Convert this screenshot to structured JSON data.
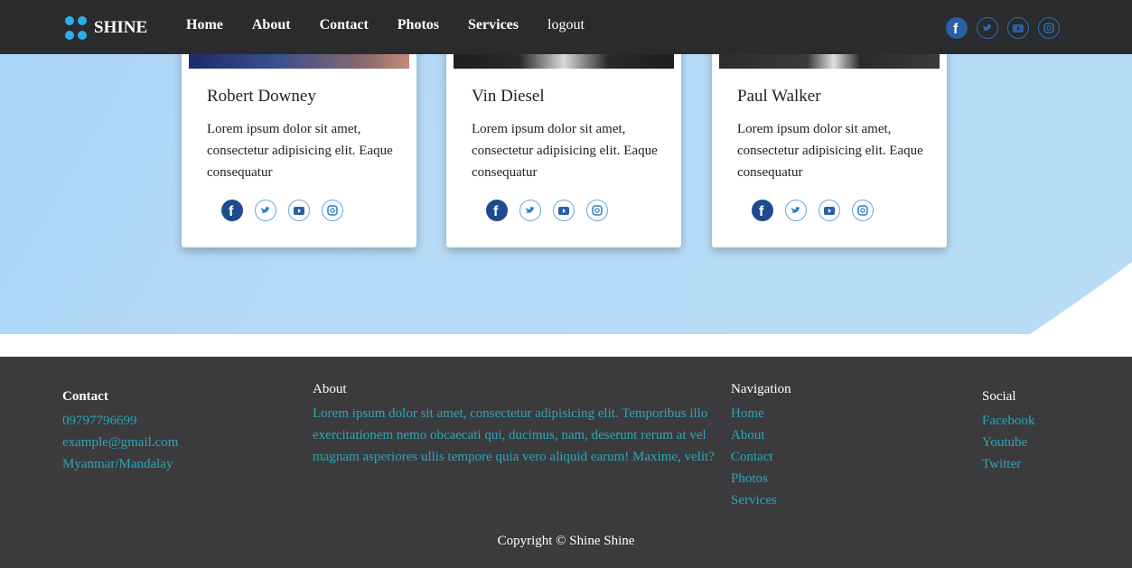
{
  "brand": {
    "name": "SHINE"
  },
  "nav": {
    "links": [
      "Home",
      "About",
      "Contact",
      "Photos",
      "Services",
      "logout"
    ],
    "social": [
      "facebook-icon",
      "twitter-icon",
      "youtube-icon",
      "instagram-icon"
    ]
  },
  "team": [
    {
      "name": "Robert Downey",
      "bio": "Lorem ipsum dolor sit amet, consectetur adipisicing elit. Eaque consequatur"
    },
    {
      "name": "Vin Diesel",
      "bio": "Lorem ipsum dolor sit amet, consectetur adipisicing elit. Eaque consequatur"
    },
    {
      "name": "Paul Walker",
      "bio": "Lorem ipsum dolor sit amet, consectetur adipisicing elit. Eaque consequatur"
    }
  ],
  "footer": {
    "contact": {
      "heading": "Contact",
      "phone": "09797796699",
      "email": "example@gmail.com",
      "location": "Myanmar/Mandalay"
    },
    "about": {
      "heading": "About",
      "text": "Lorem ipsum dolor sit amet, consectetur adipisicing elit. Temporibus illo exercitationem nemo obcaecati qui, ducimus, nam, deserunt rerum at vel magnam asperiores ullis tempore quia vero aliquid earum! Maxime, velit?"
    },
    "navigation": {
      "heading": "Navigation",
      "items": [
        "Home",
        "About",
        "Contact",
        "Photos",
        "Services"
      ]
    },
    "social": {
      "heading": "Social",
      "items": [
        "Facebook",
        "Youtube",
        "Twitter"
      ]
    },
    "copyright": "Copyright © Shine Shine"
  },
  "colors": {
    "nav_bg": "#2a2b2d",
    "hero_bg": "#b6dbf7",
    "footer_bg": "#3b3b3d",
    "link": "#2aa6b6"
  }
}
